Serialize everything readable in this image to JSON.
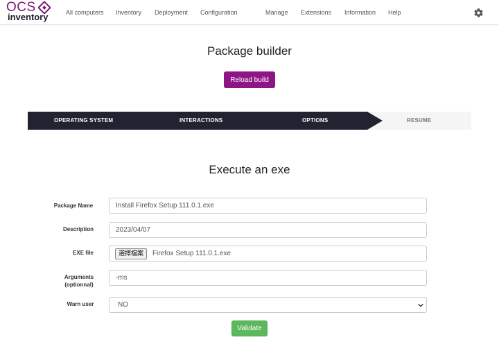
{
  "brand": {
    "logo_top": "OCS",
    "logo_bottom": "inventory"
  },
  "nav": {
    "items": [
      {
        "label": "All computers"
      },
      {
        "label": "Inventory"
      },
      {
        "label": "Deployment"
      },
      {
        "label": "Configuration"
      },
      {
        "label": "Manage"
      },
      {
        "label": "Extensions"
      },
      {
        "label": "Information"
      },
      {
        "label": "Help"
      }
    ],
    "settings_icon": "gear-icon"
  },
  "header": {
    "title": "Package builder",
    "reload_label": "Reload build"
  },
  "stepper": {
    "steps": [
      {
        "label": "OPERATING SYSTEM",
        "state": "done"
      },
      {
        "label": "INTERACTIONS",
        "state": "done"
      },
      {
        "label": "OPTIONS",
        "state": "done"
      },
      {
        "label": "RESUME",
        "state": "pending"
      }
    ]
  },
  "form": {
    "title": "Execute an exe",
    "package_name": {
      "label": "Package Name",
      "value": "Install Firefox Setup 111.0.1.exe"
    },
    "description": {
      "label": "Description",
      "value": "2023/04/07"
    },
    "exe_file": {
      "label": "EXE file",
      "button_label": "選擇檔案",
      "file_name": "Firefox Setup 111.0.1.exe"
    },
    "arguments": {
      "label_line1": "Arguments",
      "label_line2": "(optionnal)",
      "value": "-ms"
    },
    "warn_user": {
      "label": "Warn user",
      "selected": "NO"
    },
    "validate_label": "Validate"
  },
  "colors": {
    "accent": "#8e1585",
    "stepper_dark": "#212330",
    "success": "#5cb85c"
  }
}
